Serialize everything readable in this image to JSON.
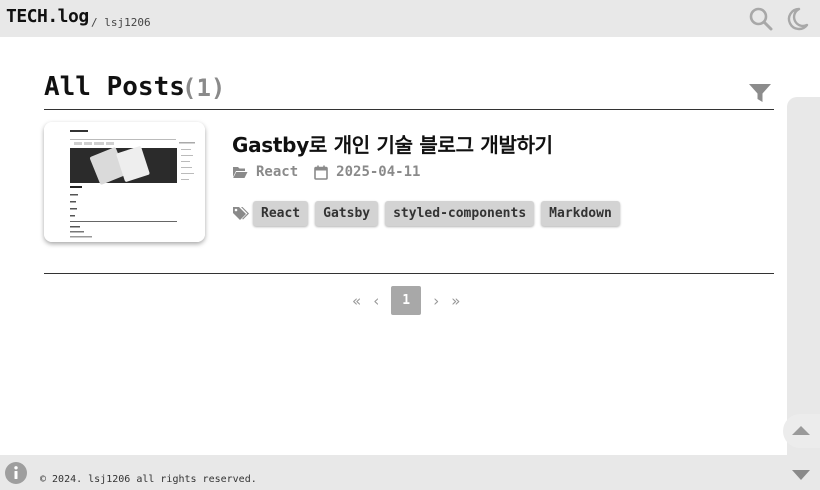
{
  "header": {
    "brand": "TECH.log",
    "sub": "/ lsj1206",
    "icons": [
      "search-icon",
      "moon-icon"
    ]
  },
  "main": {
    "title": "All Posts",
    "count": "(1)",
    "filter_icon": "filter-icon"
  },
  "post": {
    "title": "Gastby로 개인 기술 블로그 개발하기",
    "category": "React",
    "date": "2025-04-11",
    "tags": [
      "React",
      "Gatsby",
      "styled-components",
      "Markdown"
    ]
  },
  "pagination": {
    "first": "«",
    "prev": "‹",
    "current": "1",
    "next": "›",
    "last": "»"
  },
  "footer": {
    "copyright": "© 2024. lsj1206 all rights reserved."
  },
  "colors": {
    "bar_bg": "#e8e8e8",
    "muted": "#8a8a8a",
    "tag_bg": "#d3d3d3",
    "page_active": "#a8a8a8"
  }
}
